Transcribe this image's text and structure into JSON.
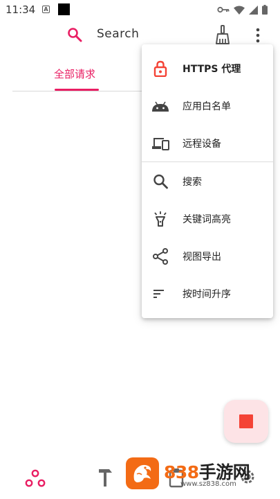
{
  "status_bar": {
    "time": "11:34",
    "a_icon_letter": "A"
  },
  "toolbar": {
    "search_label": "Search"
  },
  "tabs": {
    "items": [
      {
        "label": "全部请求",
        "selected": true
      }
    ]
  },
  "menu": {
    "items": [
      {
        "icon": "lock-icon",
        "label": "HTTPS 代理",
        "bold": true,
        "icon_color": "#f44336"
      },
      {
        "icon": "android-icon",
        "label": "应用白名单"
      },
      {
        "icon": "devices-icon",
        "label": "远程设备"
      },
      {
        "icon": "search-icon",
        "label": "搜索"
      },
      {
        "icon": "lightbulb-icon",
        "label": "关键词高亮"
      },
      {
        "icon": "share-icon",
        "label": "视图导出"
      },
      {
        "icon": "sort-icon",
        "label": "按时间升序"
      }
    ]
  },
  "fab": {
    "icon": "stop-icon",
    "color": "#f44336",
    "background": "#fde3e6"
  },
  "bottom_nav": {
    "items": [
      {
        "icon": "network-icon",
        "active": true
      },
      {
        "icon": "tools-icon"
      },
      {
        "icon": "clipboard-icon"
      },
      {
        "icon": "settings-icon"
      }
    ]
  },
  "watermark": {
    "brand_number": "838",
    "brand_text": "手游网",
    "url": "www.sz838.com"
  },
  "colors": {
    "accent": "#e91e63",
    "watermark": "#f36b15"
  }
}
